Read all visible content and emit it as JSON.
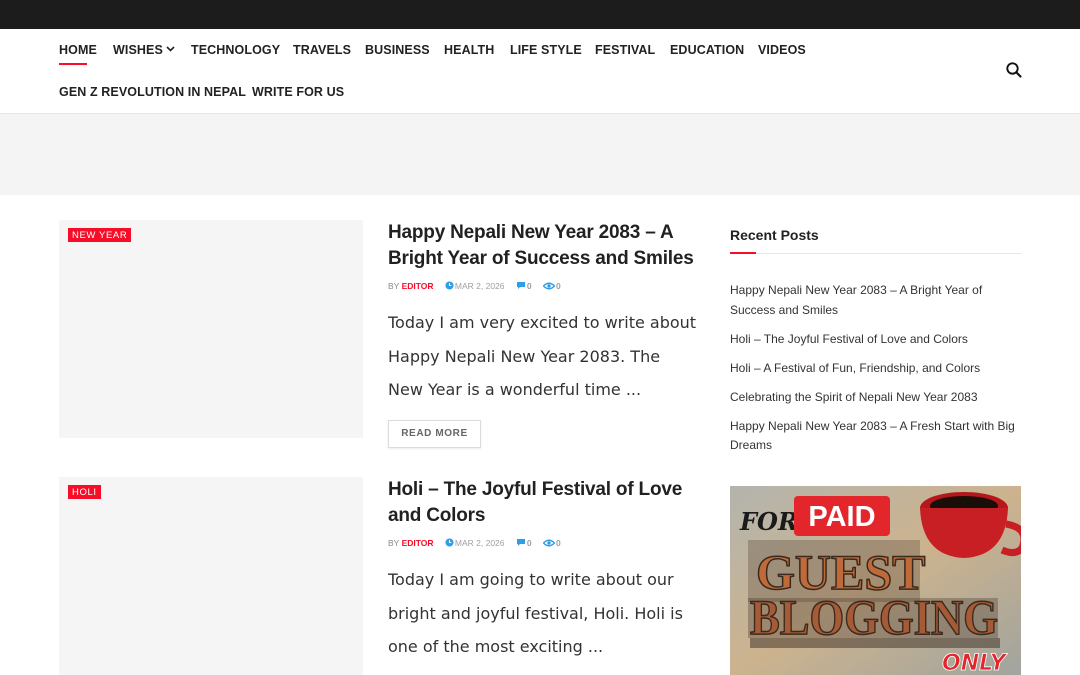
{
  "nav": {
    "items": [
      {
        "label": "HOME",
        "active": true
      },
      {
        "label": "WISHES",
        "has_dropdown": true
      },
      {
        "label": "TECHNOLOGY"
      },
      {
        "label": "TRAVELS"
      },
      {
        "label": "BUSINESS"
      },
      {
        "label": "HEALTH"
      },
      {
        "label": "LIFE STYLE"
      },
      {
        "label": "FESTIVAL"
      },
      {
        "label": "EDUCATION"
      },
      {
        "label": "VIDEOS"
      },
      {
        "label": "GEN Z REVOLUTION IN NEPAL"
      },
      {
        "label": "WRITE FOR US"
      }
    ],
    "search_icon": "search-icon"
  },
  "posts": [
    {
      "category": "NEW YEAR",
      "title": "Happy Nepali New Year 2083 – A Bright Year of Success and Smiles",
      "by": "BY",
      "author": "EDITOR",
      "date": "MAR 2, 2026",
      "comments": "0",
      "views": "0",
      "excerpt": "Today I am very excited to write about Happy Nepali New Year 2083. The New Year is a wonderful time ...",
      "read_more": "READ MORE"
    },
    {
      "category": "HOLI",
      "title": "Holi – The Joyful Festival of Love and Colors",
      "by": "BY",
      "author": "EDITOR",
      "date": "MAR 2, 2026",
      "comments": "0",
      "views": "0",
      "excerpt": "Today I am going to write about our bright and joyful festival, Holi. Holi is one of the most exciting ..."
    }
  ],
  "sidebar": {
    "title": "Recent Posts",
    "recent": [
      "Happy Nepali New Year 2083 – A Bright Year of Success and Smiles",
      "Holi – The Joyful Festival of Love and Colors",
      "Holi – A Festival of Fun, Friendship, and Colors",
      "Celebrating the Spirit of Nepali New Year 2083",
      "Happy Nepali New Year 2083 – A Fresh Start with Big Dreams"
    ],
    "ad": {
      "for": "FOR",
      "paid": "PAID",
      "line1": "GUEST",
      "line2": "BLOGGING",
      "only": "ONLY"
    }
  },
  "colors": {
    "accent": "#f70d28",
    "topbar": "#1c1c1c",
    "meta_icon": "#2f9ee8"
  }
}
